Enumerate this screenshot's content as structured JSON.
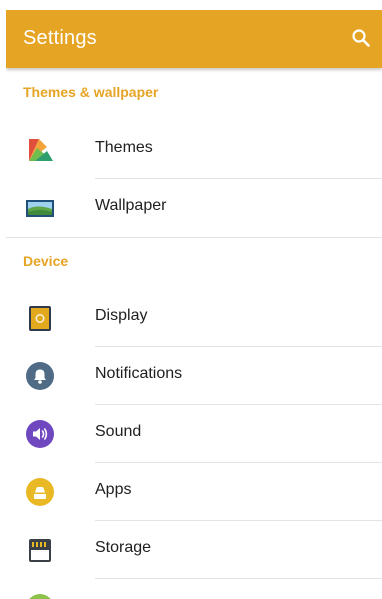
{
  "app_bar": {
    "title": "Settings",
    "search_icon": "search-icon",
    "color": "#e6a424"
  },
  "sections": [
    {
      "header": "Themes & wallpaper",
      "items": [
        {
          "label": "Themes",
          "icon": "themes-icon"
        },
        {
          "label": "Wallpaper",
          "icon": "wallpaper-icon"
        }
      ]
    },
    {
      "header": "Device",
      "items": [
        {
          "label": "Display",
          "icon": "display-icon"
        },
        {
          "label": "Notifications",
          "icon": "notifications-icon"
        },
        {
          "label": "Sound",
          "icon": "sound-icon"
        },
        {
          "label": "Apps",
          "icon": "apps-icon"
        },
        {
          "label": "Storage",
          "icon": "storage-icon"
        }
      ]
    }
  ],
  "colors": {
    "accent": "#e6a424",
    "notifications": "#4f6b85",
    "sound": "#6f48c0",
    "apps": "#e8b825",
    "display": "#e2a81e",
    "battery_partial": "#8cc24a"
  }
}
